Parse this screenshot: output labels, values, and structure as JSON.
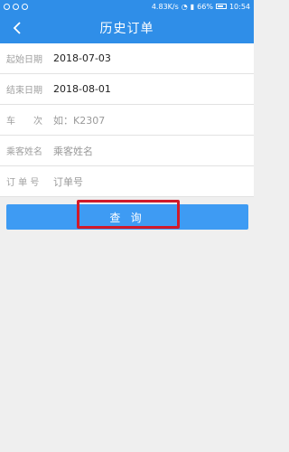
{
  "status": {
    "speed": "4.83K/s",
    "battery": "66%",
    "time": "10:54"
  },
  "header": {
    "title": "历史订单"
  },
  "form": {
    "start_date": {
      "label": "起始日期",
      "value": "2018-07-03"
    },
    "end_date": {
      "label": "结束日期",
      "value": "2018-08-01"
    },
    "train": {
      "label": "车　　次",
      "placeholder": "如：K2307"
    },
    "passenger": {
      "label": "乘客姓名",
      "placeholder": "乘客姓名"
    },
    "order": {
      "label": "订 单 号",
      "placeholder": "订单号"
    }
  },
  "query_button": {
    "label": "查 询"
  },
  "colors": {
    "accent": "#2f8ee8",
    "button": "#3e9bf3",
    "highlight": "#d11a2a"
  }
}
